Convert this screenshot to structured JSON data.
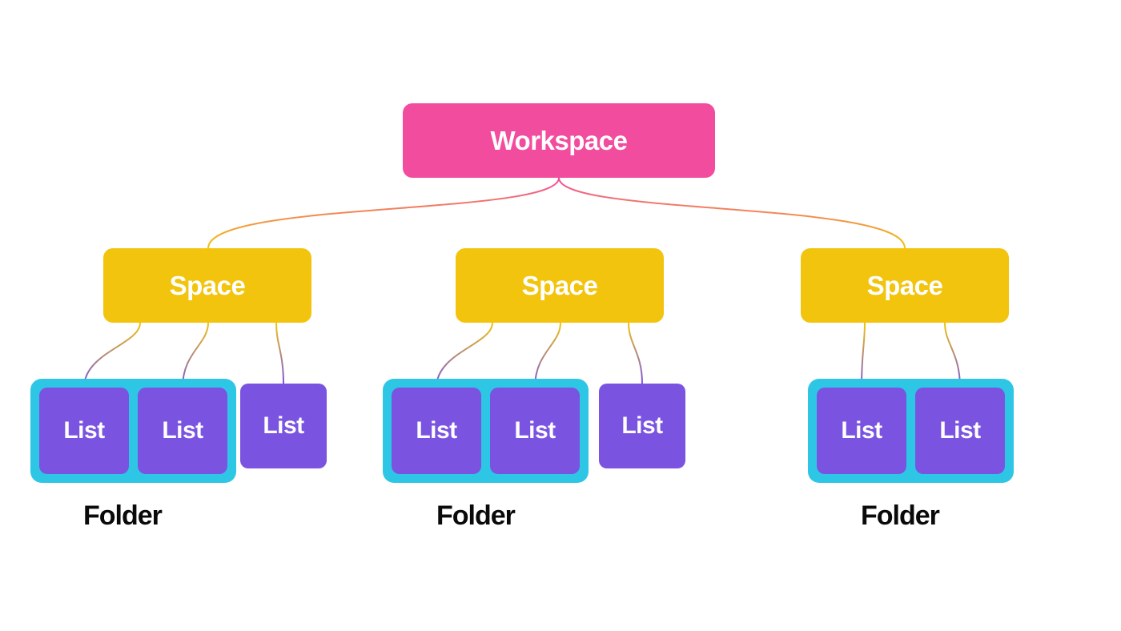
{
  "hierarchy": {
    "root": {
      "label": "Workspace"
    },
    "spaces": [
      {
        "label": "Space"
      },
      {
        "label": "Space"
      },
      {
        "label": "Space"
      }
    ],
    "folders": [
      {
        "label": "Folder",
        "lists": [
          {
            "label": "List"
          },
          {
            "label": "List"
          }
        ],
        "standalone_list": {
          "label": "List"
        }
      },
      {
        "label": "Folder",
        "lists": [
          {
            "label": "List"
          },
          {
            "label": "List"
          }
        ],
        "standalone_list": {
          "label": "List"
        }
      },
      {
        "label": "Folder",
        "lists": [
          {
            "label": "List"
          },
          {
            "label": "List"
          }
        ]
      }
    ]
  },
  "colors": {
    "workspace": "#f24c9e",
    "space": "#f2c40e",
    "folder": "#2ec6e5",
    "list": "#7a54e0",
    "text_dark": "#0a0a0a"
  }
}
